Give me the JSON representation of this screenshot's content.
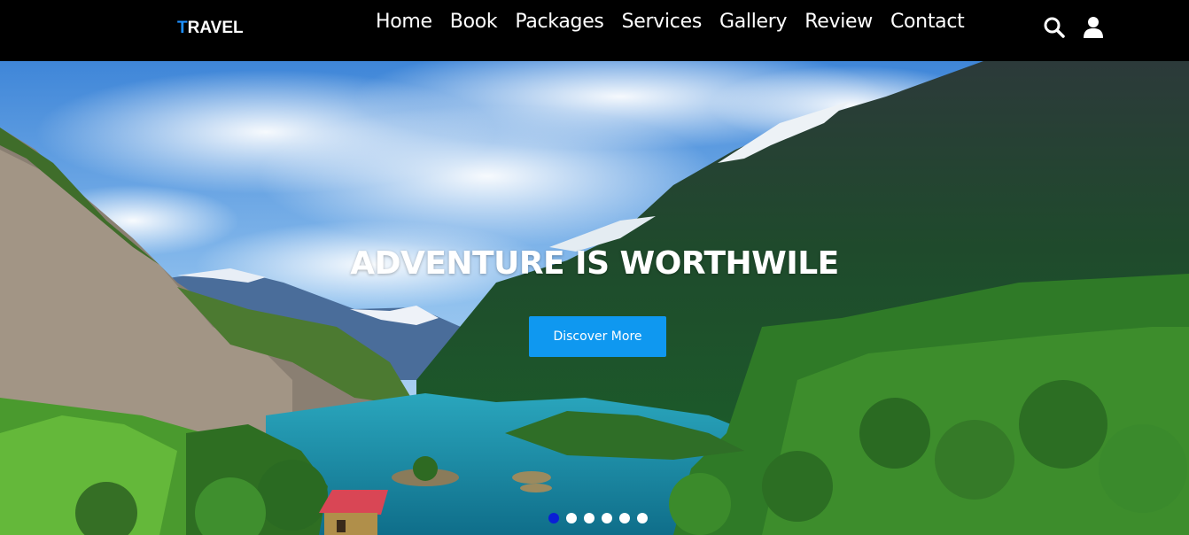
{
  "brand": {
    "first_letter": "T",
    "rest": "RAVEL"
  },
  "nav": {
    "links": [
      "Home",
      "Book",
      "Packages",
      "Services",
      "Gallery",
      "Review",
      "Contact"
    ],
    "icons": [
      "search-icon",
      "user-icon"
    ]
  },
  "hero": {
    "title": "ADVENTURE IS WORTHWILE",
    "button_label": "Discover More",
    "slides": 6,
    "active_slide": 1
  },
  "colors": {
    "accent": "#0f98f0",
    "active_dot": "#0a1fd6",
    "header_bg": "#000000"
  }
}
